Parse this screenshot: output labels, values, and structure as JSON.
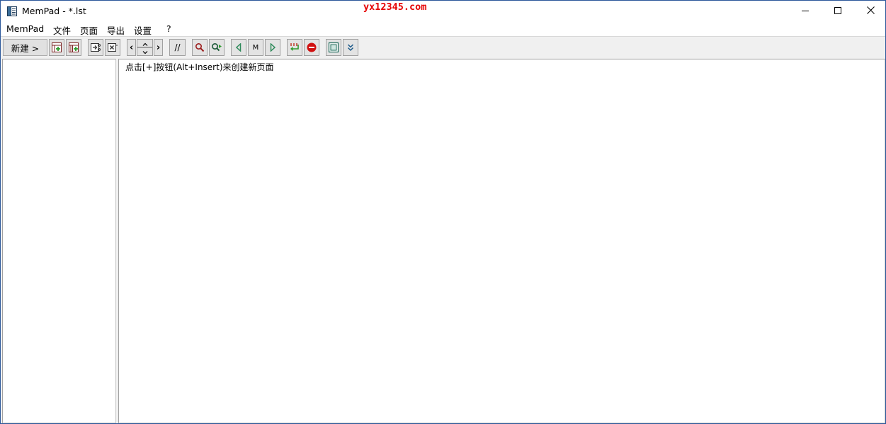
{
  "window": {
    "title": "MemPad - *.lst",
    "watermark": "yx12345.com",
    "controls": {
      "minimize_icon": "minimize-icon",
      "maximize_icon": "maximize-icon",
      "close_icon": "close-icon"
    }
  },
  "menu": {
    "items": [
      "MemPad",
      "文件",
      "页面",
      "导出",
      "设置",
      "?"
    ]
  },
  "toolbar": {
    "new_label": "新建 >",
    "prev_label": "‹",
    "next_label": "›",
    "comment_label": "//",
    "marker_label": "M",
    "icons": [
      "add-page-icon",
      "add-subpage-icon",
      "cut-page-icon",
      "delete-page-icon",
      "nav-left-icon",
      "move-up-icon",
      "move-down-icon",
      "nav-right-icon",
      "comment-icon",
      "search-icon",
      "search-next-icon",
      "prev-marker-icon",
      "marker-icon",
      "next-marker-icon",
      "wrap-icon",
      "stop-icon",
      "window-icon",
      "expand-icon"
    ]
  },
  "editor": {
    "placeholder_text": "点击[+]按钮(Alt+Insert)来创建新页面"
  },
  "colors": {
    "window_border": "#2b579a",
    "watermark": "#e60000",
    "toolbar_bg": "#f0f0f0",
    "stop_red": "#d01010",
    "green": "#2e9a2e"
  }
}
